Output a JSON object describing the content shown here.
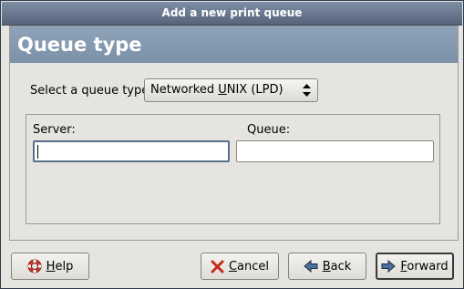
{
  "window": {
    "title": "Add a new print queue"
  },
  "header": {
    "title": "Queue type"
  },
  "queue_type": {
    "label": "Select a queue type:",
    "selected_prefix": "Networked ",
    "selected_mnemonic": "U",
    "selected_suffix": "NIX (LPD)"
  },
  "fields": {
    "server_label": "Server:",
    "server_value": "",
    "queue_label": "Queue:",
    "queue_value": ""
  },
  "buttons": {
    "help": {
      "mnemonic": "H",
      "rest": "elp",
      "icon": "lifebuoy-icon"
    },
    "cancel": {
      "mnemonic": "C",
      "rest": "ancel",
      "icon": "red-x-icon"
    },
    "back": {
      "mnemonic": "B",
      "rest": "ack",
      "icon": "arrow-left-icon"
    },
    "forward": {
      "mnemonic": "F",
      "rest": "orward",
      "icon": "arrow-right-icon"
    }
  },
  "colors": {
    "titlebar": "#6b7a92",
    "header_band": "#8499b0",
    "window_bg": "#e6e4e0",
    "focus_border": "#5b6f8a"
  }
}
